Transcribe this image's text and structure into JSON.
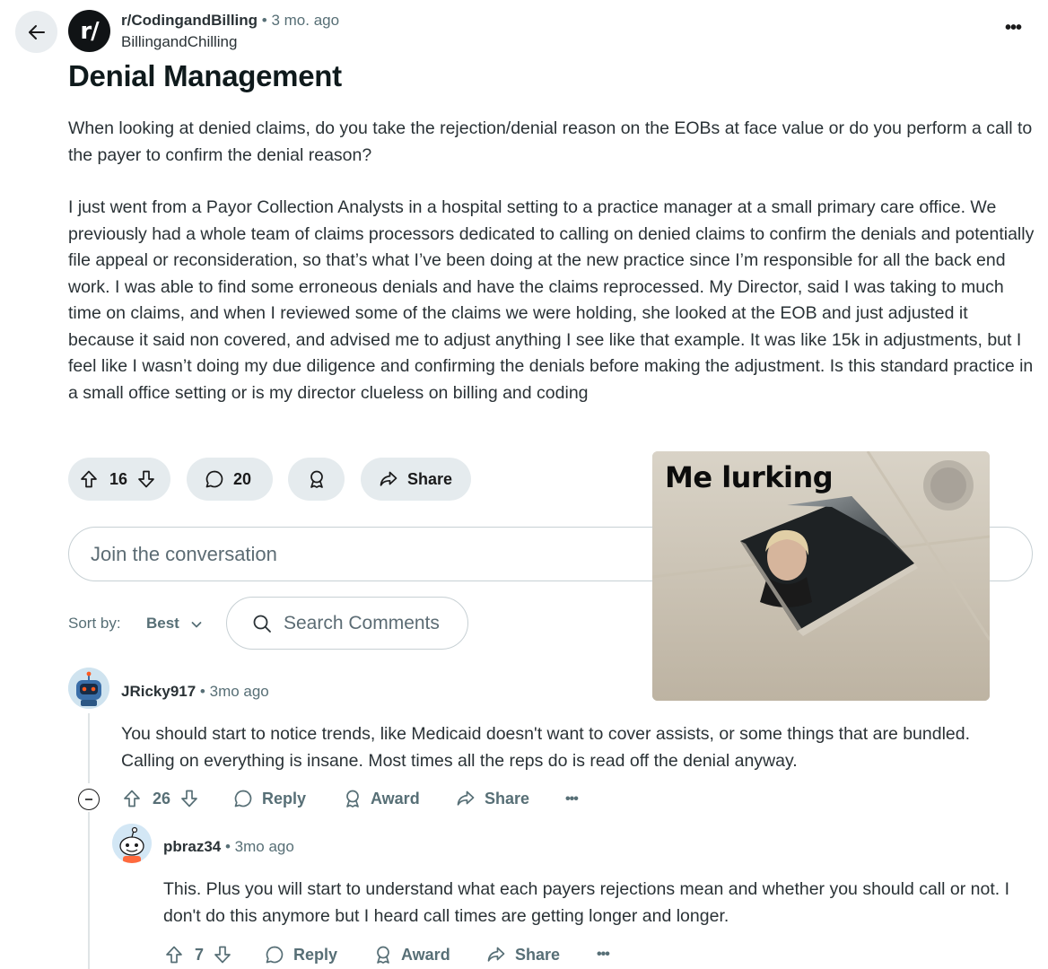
{
  "post": {
    "subreddit": "r/CodingandBilling",
    "dot": "•",
    "time": "3 mo. ago",
    "author": "BillingandChilling",
    "title": "Denial Management",
    "paragraphs": [
      "When looking at denied claims, do you take the rejection/denial reason on the EOBs at face value or do you perform a call to the payer to confirm the denial reason?",
      "I just went from a Payor Collection Analysts in a hospital setting to a practice manager at a small primary care office. We previously had a whole team of claims processors dedicated to calling on denied claims to confirm the denials and potentially file appeal or reconsideration, so that’s what I’ve been doing at the new practice since I’m responsible for all the back end work. I was able to find some erroneous denials and have the claims reprocessed. My Director, said I was taking to much time on claims, and when I reviewed some of the claims we were holding, she looked at the EOB and just adjusted it because it said non covered, and advised me to adjust anything I see like that example. It was like 15k in adjustments, but I feel like I wasn’t doing my due diligence and confirming the denials before making the adjustment. Is this standard practice in a small office setting or is my director clueless on billing and coding"
    ],
    "votes": "16",
    "comments": "20",
    "share_label": "Share",
    "more": "•••"
  },
  "meme": {
    "caption": "Me lurking"
  },
  "join": {
    "placeholder": "Join the conversation"
  },
  "sort": {
    "label": "Sort by:",
    "value": "Best"
  },
  "search": {
    "placeholder": "Search Comments"
  },
  "comments": [
    {
      "author": "JRicky917",
      "time": "3mo ago",
      "body": "You should start to notice trends, like Medicaid doesn't want to cover assists, or some things that are bundled. Calling on everything is insane. Most times all the reps do is read off the denial anyway.",
      "votes": "26",
      "reply": "Reply",
      "award": "Award",
      "share": "Share",
      "more": "•••"
    },
    {
      "author": "pbraz34",
      "time": "3mo ago",
      "body": "This. Plus you will start to understand what each payers rejections mean and whether you should call or not. I don't do this anymore but I heard call times are getting longer and longer.",
      "votes": "7",
      "reply": "Reply",
      "award": "Award",
      "share": "Share",
      "more": "•••"
    }
  ],
  "colors": {
    "pill_bg": "#e5ebee",
    "meta_text": "#576f76",
    "body_text": "#2a3236",
    "border": "#c7d0d4"
  },
  "icons": [
    "back-arrow-icon",
    "subreddit-icon",
    "upvote-icon",
    "downvote-icon",
    "comment-icon",
    "award-icon",
    "share-icon",
    "search-icon",
    "chevron-down-icon",
    "collapse-icon",
    "more-icon"
  ]
}
